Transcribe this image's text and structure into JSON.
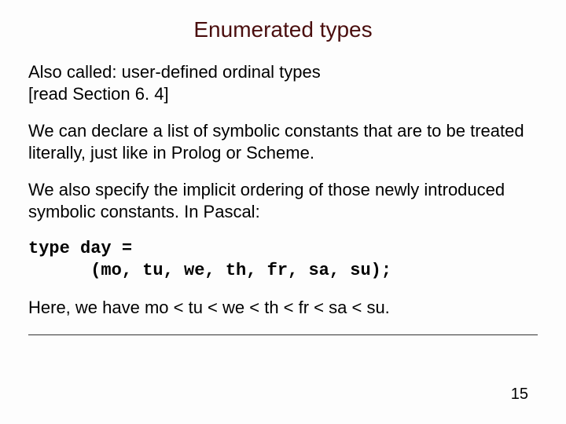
{
  "title": "Enumerated types",
  "p1a": "Also called: user-defined ordinal types",
  "p1b": "[read Section 6. 4]",
  "p2": "We can declare a list of symbolic constants that are to be treated literally, just like in Prolog or Scheme.",
  "p3": "We also specify the implicit ordering of those newly introduced symbolic constants. In Pascal:",
  "code": "type day =\n      (mo, tu, we, th, fr, sa, su);",
  "p4": "Here, we have mo < tu < we < th < fr < sa < su.",
  "page": "15"
}
